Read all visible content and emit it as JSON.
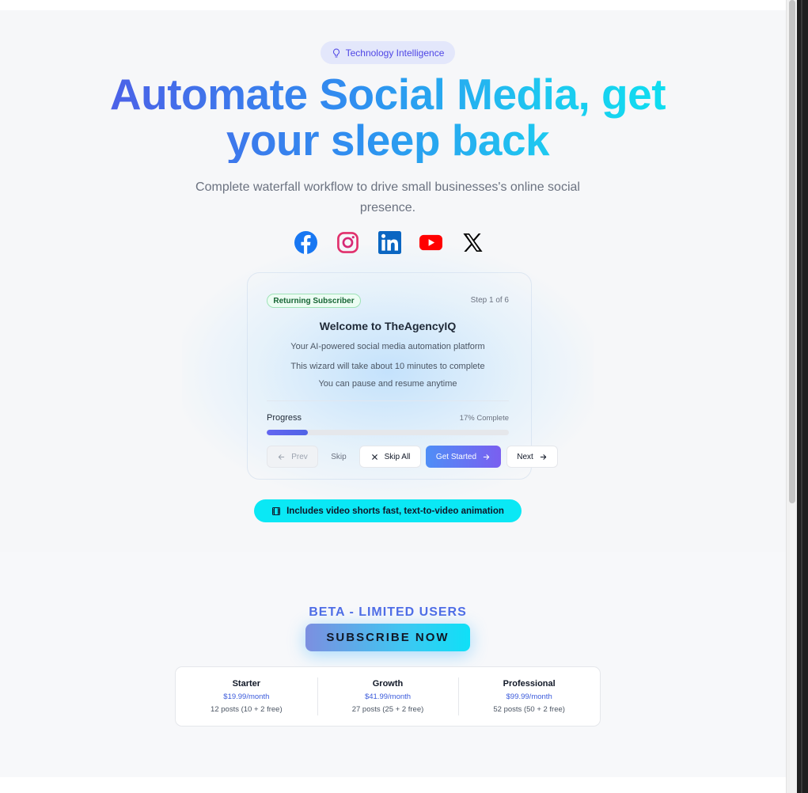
{
  "badge": {
    "label": "Technology Intelligence",
    "icon": "lightbulb-icon"
  },
  "hero": {
    "headline": "Automate Social Media, get your sleep back",
    "subtitle": "Complete waterfall workflow to drive small businesses's online social presence."
  },
  "social": [
    {
      "name": "facebook-icon",
      "color": "#1877f2"
    },
    {
      "name": "instagram-icon",
      "color": "#e1306c"
    },
    {
      "name": "linkedin-icon",
      "color": "#0a66c2"
    },
    {
      "name": "youtube-icon",
      "color": "#ff0000"
    },
    {
      "name": "x-icon",
      "color": "#000000"
    }
  ],
  "wizard": {
    "status_pill": "Returning Subscriber",
    "step": "Step 1 of 6",
    "title": "Welcome to TheAgencyIQ",
    "line1": "Your AI-powered social media automation platform",
    "line2": "This wizard will take about 10 minutes to complete",
    "line3": "You can pause and resume anytime",
    "progress_label": "Progress",
    "progress_text": "17% Complete",
    "progress_value": 0.17,
    "buttons": {
      "prev": "Prev",
      "skip": "Skip",
      "skip_all": "Skip All",
      "get_started": "Get Started",
      "next": "Next"
    }
  },
  "video_pill": "Includes video shorts fast, text-to-video animation",
  "beta": {
    "label": "BETA - LIMITED USERS",
    "cta": "SUBSCRIBE NOW"
  },
  "plans": [
    {
      "name": "Starter",
      "price": "$19.99/month",
      "posts": "12 posts (10 + 2 free)"
    },
    {
      "name": "Growth",
      "price": "$41.99/month",
      "posts": "27 posts (25 + 2 free)"
    },
    {
      "name": "Professional",
      "price": "$99.99/month",
      "posts": "52 posts (50 + 2 free)"
    }
  ],
  "colors": {
    "accent": "#4f46e5",
    "cyan": "#0ae8f5",
    "green_pill": "#ecfdf3"
  }
}
